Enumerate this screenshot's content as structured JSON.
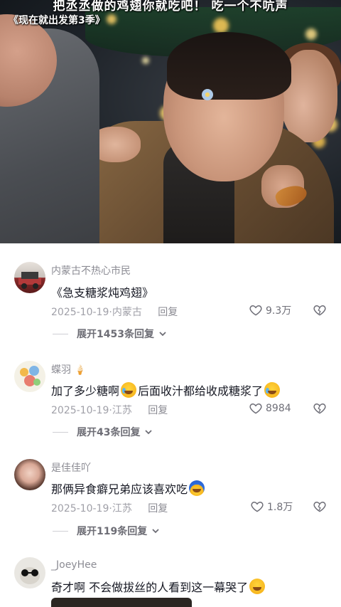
{
  "video": {
    "top_caption": "把丞丞做的鸡翅你就吃吧！   吃一个不吭声",
    "show_title": "《现在就出发第3季》"
  },
  "comments": [
    {
      "username": "内蒙古不热心市民",
      "text": "《急支糖浆炖鸡翅》",
      "date": "2025-10-19",
      "location": "内蒙古",
      "reply_label": "回复",
      "likes": "9.3万",
      "expand_label": "展开1453条回复"
    },
    {
      "username": "蝶羽",
      "text_before": "加了多少糖啊",
      "text_middle": "后面收汁都给收成糖浆了",
      "date": "2025-10-19",
      "location": "江苏",
      "reply_label": "回复",
      "likes": "8984",
      "expand_label": "展开43条回复"
    },
    {
      "username": "是佳佳吖",
      "text": "那俩异食癖兄弟应该喜欢吃",
      "date": "2025-10-19",
      "location": "江苏",
      "reply_label": "回复",
      "likes": "1.8万",
      "expand_label": "展开119条回复"
    },
    {
      "username": "_JoeyHee",
      "text": "奇才啊 不会做拔丝的人看到这一幕哭了"
    }
  ],
  "icons": {
    "like": "heart-icon",
    "dislike": "broken-heart-icon",
    "expand": "chevron-down-icon"
  }
}
